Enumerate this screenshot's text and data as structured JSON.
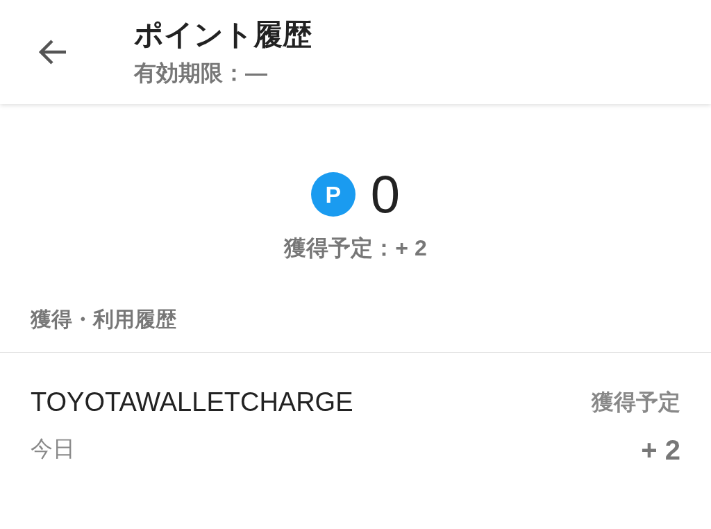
{
  "header": {
    "title": "ポイント履歴",
    "subtitle": "有効期限：—"
  },
  "balance": {
    "icon_letter": "P",
    "points": "0",
    "pending": "獲得予定：+ 2"
  },
  "history": {
    "heading": "獲得・利用履歴",
    "items": [
      {
        "name": "TOYOTAWALLETCHARGE",
        "date": "今日",
        "status": "獲得予定",
        "amount": "+ 2"
      }
    ]
  }
}
